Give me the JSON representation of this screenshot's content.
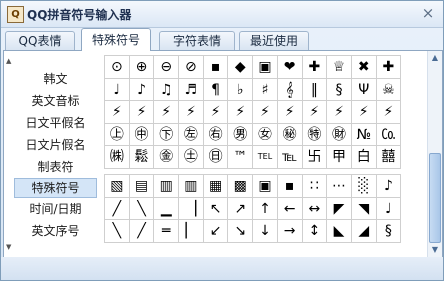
{
  "app": {
    "title": "QQ拼音符号输入器",
    "close_glyph": "×",
    "icon_glyph": "Q"
  },
  "tabs": [
    {
      "label": "QQ表情",
      "active": false
    },
    {
      "label": "特殊符号",
      "active": true
    },
    {
      "label": "字符表情",
      "active": false
    },
    {
      "label": "最近使用",
      "active": false
    }
  ],
  "sidebar": {
    "items": [
      {
        "label": "韩文"
      },
      {
        "label": "英文音标"
      },
      {
        "label": "日文平假名"
      },
      {
        "label": "日文片假名"
      },
      {
        "label": "制表符"
      },
      {
        "label": "特殊符号",
        "active": true
      },
      {
        "label": "时间/日期"
      },
      {
        "label": "英文序号"
      }
    ]
  },
  "symbols_upper": [
    [
      "⊙",
      "⊕",
      "⊖",
      "⊘",
      "▪",
      "◆",
      "▣",
      "❤",
      "✚",
      "♕",
      "✖",
      "✚"
    ],
    [
      "♩",
      "♪",
      "♫",
      "♬",
      "¶",
      "♭",
      "♯",
      "𝄞",
      "‖",
      "§",
      "Ψ",
      "☠"
    ],
    [
      "⚡",
      "⚡",
      "⚡",
      "⚡",
      "⚡",
      "⚡",
      "⚡",
      "⚡",
      "⚡",
      "⚡",
      "⚡",
      "⚡"
    ],
    [
      "㊤",
      "㊥",
      "㊦",
      "㊧",
      "㊨",
      "㊚",
      "㊛",
      "㊙",
      "㊕",
      "㊖",
      "№",
      "㏇"
    ],
    [
      "㈱",
      "鬆",
      "㊎",
      "㊏",
      "㊐",
      "™",
      "TEL",
      "℡",
      "卐",
      "甲",
      "白",
      "囍"
    ]
  ],
  "symbols_lower": [
    [
      "▧",
      "▤",
      "▥",
      "▥",
      "▦",
      "▩",
      "▣",
      "▪",
      "∷",
      "⋯",
      "░",
      "♪"
    ],
    [
      "╱",
      "╲",
      "▁",
      "▕",
      "↖",
      "↗",
      "↑",
      "←",
      "↔",
      "◤",
      "◥",
      "♩"
    ],
    [
      "╲",
      "╱",
      "═",
      "▏",
      "↙",
      "↘",
      "↓",
      "→",
      "↕",
      "◣",
      "◢",
      "§"
    ]
  ],
  "scrollbar": {
    "up": "▲",
    "down": "▼"
  }
}
